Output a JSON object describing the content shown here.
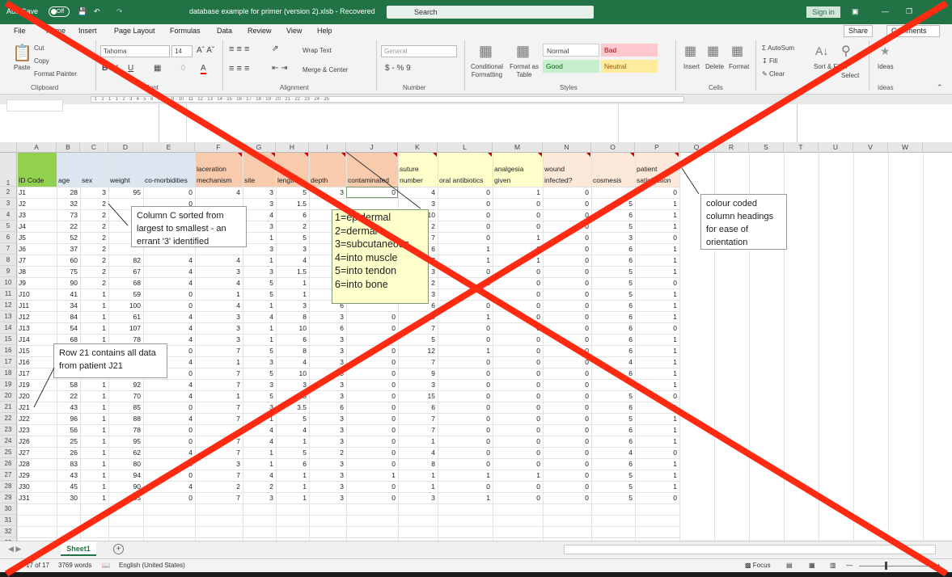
{
  "window": {
    "autosave": "AutoSave",
    "autosave_state": "Off",
    "title": "database example for primer (version 2).xlsb  -  Recovered",
    "search": "Search",
    "signin": "Sign in"
  },
  "menu": {
    "items": [
      "File",
      "Home",
      "Insert",
      "Page Layout",
      "Formulas",
      "Data",
      "Review",
      "View",
      "Help"
    ],
    "share": "Share",
    "comments": "Comments"
  },
  "ribbon": {
    "paste": "Paste",
    "cut": "Cut",
    "copy": "Copy",
    "format_painter": "Format Painter",
    "clipboard": "Clipboard",
    "font_name": "Tahoma",
    "font_size": "14",
    "font": "Font",
    "wrap_text": "Wrap Text",
    "merge_center": "Merge & Center",
    "alignment": "Alignment",
    "number_format": "General",
    "number": "Number",
    "conditional_formatting": "Conditional Formatting",
    "format_as_table": "Format as Table",
    "style_normal": "Normal",
    "style_bad": "Bad",
    "style_good": "Good",
    "style_neutral": "Neutral",
    "styles": "Styles",
    "insert": "Insert",
    "delete": "Delete",
    "format": "Format",
    "cells": "Cells",
    "autosum": "AutoSum",
    "fill": "Fill",
    "clear": "Clear",
    "sort_filter": "Sort & Filter",
    "find_select": "Select",
    "ideas": "Ideas",
    "ideas_group": "Ideas"
  },
  "columns": [
    "A",
    "B",
    "C",
    "D",
    "E",
    "F",
    "G",
    "H",
    "I",
    "J",
    "K",
    "L",
    "M",
    "N",
    "O",
    "P",
    "Q",
    "R",
    "S",
    "T",
    "U",
    "V",
    "W"
  ],
  "headers": {
    "line1": [
      "",
      "",
      "",
      "",
      "",
      "laceration",
      "",
      "",
      "",
      "",
      "suture",
      "",
      "analgesia",
      "wound",
      "",
      "patient"
    ],
    "line2": [
      "ID Code",
      "age",
      "sex",
      "weight",
      "co-morbidities",
      "mechanism",
      "site",
      "length",
      "depth",
      "contaminated",
      "number",
      "oral antibiotics",
      "given",
      "infected?",
      "cosmesis",
      "satisfaction"
    ]
  },
  "colors": {
    "excel_green": "#217346",
    "hdr_green": "#92d050",
    "hdr_blue": "#dce6f1",
    "hdr_orange": "#f8cbad",
    "hdr_yellow": "#ffffcc",
    "hdr_peach": "#fde9d9",
    "cross": "#ff2a12"
  },
  "rows": [
    [
      "J1",
      "28",
      "3",
      "95",
      "0",
      "4",
      "3",
      "5",
      "3",
      "0",
      "4",
      "0",
      "1",
      "0",
      "",
      "0"
    ],
    [
      "J2",
      "32",
      "2",
      "",
      "0",
      "",
      "3",
      "1.5",
      "",
      "",
      "3",
      "0",
      "0",
      "0",
      "5",
      "1"
    ],
    [
      "J3",
      "73",
      "2",
      "",
      "",
      "",
      "4",
      "6",
      "",
      "",
      "10",
      "0",
      "0",
      "0",
      "6",
      "1"
    ],
    [
      "J4",
      "22",
      "2",
      "",
      "",
      "",
      "3",
      "2",
      "",
      "",
      "2",
      "0",
      "0",
      "0",
      "5",
      "1"
    ],
    [
      "J5",
      "52",
      "2",
      "",
      "",
      "",
      "1",
      "5",
      "",
      "",
      "7",
      "0",
      "1",
      "0",
      "3",
      "0"
    ],
    [
      "J6",
      "37",
      "2",
      "",
      "",
      "",
      "3",
      "3",
      "",
      "",
      "6",
      "1",
      "0",
      "0",
      "6",
      "1"
    ],
    [
      "J7",
      "60",
      "2",
      "82",
      "4",
      "4",
      "1",
      "4",
      "",
      "",
      "7",
      "1",
      "1",
      "0",
      "6",
      "1"
    ],
    [
      "J8",
      "75",
      "2",
      "67",
      "4",
      "3",
      "3",
      "1.5",
      "",
      "",
      "3",
      "0",
      "0",
      "0",
      "5",
      "1"
    ],
    [
      "J9",
      "90",
      "2",
      "68",
      "4",
      "4",
      "5",
      "1",
      "",
      "",
      "2",
      "1",
      "0",
      "0",
      "5",
      "0"
    ],
    [
      "J10",
      "41",
      "1",
      "59",
      "0",
      "1",
      "5",
      "1",
      "",
      "",
      "3",
      "1",
      "0",
      "0",
      "5",
      "1"
    ],
    [
      "J11",
      "34",
      "1",
      "100",
      "0",
      "4",
      "1",
      "3",
      "6",
      "",
      "6",
      "0",
      "0",
      "0",
      "6",
      "1"
    ],
    [
      "J12",
      "84",
      "1",
      "61",
      "4",
      "3",
      "4",
      "8",
      "3",
      "0",
      "0",
      "1",
      "0",
      "0",
      "6",
      "1"
    ],
    [
      "J13",
      "54",
      "1",
      "107",
      "4",
      "3",
      "1",
      "10",
      "6",
      "0",
      "7",
      "0",
      "0",
      "0",
      "6",
      "0"
    ],
    [
      "J14",
      "68",
      "1",
      "78",
      "4",
      "3",
      "1",
      "6",
      "3",
      "0",
      "5",
      "0",
      "0",
      "0",
      "6",
      "1"
    ],
    [
      "J15",
      "",
      "",
      "",
      "0",
      "7",
      "5",
      "8",
      "3",
      "0",
      "12",
      "1",
      "0",
      "0",
      "6",
      "1"
    ],
    [
      "J16",
      "",
      "",
      "",
      "4",
      "1",
      "3",
      "4",
      "3",
      "0",
      "7",
      "0",
      "0",
      "0",
      "4",
      "1"
    ],
    [
      "J17",
      "",
      "",
      "",
      "0",
      "7",
      "5",
      "10",
      "3",
      "0",
      "9",
      "0",
      "0",
      "0",
      "6",
      "1"
    ],
    [
      "J19",
      "58",
      "1",
      "92",
      "4",
      "7",
      "3",
      "3",
      "3",
      "0",
      "3",
      "0",
      "0",
      "0",
      "",
      "1"
    ],
    [
      "J20",
      "22",
      "1",
      "70",
      "4",
      "1",
      "5",
      "8",
      "3",
      "0",
      "15",
      "0",
      "0",
      "0",
      "5",
      "0"
    ],
    [
      "J21",
      "43",
      "1",
      "85",
      "0",
      "7",
      "3",
      "3.5",
      "6",
      "0",
      "6",
      "0",
      "0",
      "0",
      "6",
      "1"
    ],
    [
      "J22",
      "96",
      "1",
      "88",
      "4",
      "7",
      "1",
      "5",
      "3",
      "0",
      "7",
      "0",
      "0",
      "0",
      "5",
      "1"
    ],
    [
      "J23",
      "56",
      "1",
      "78",
      "0",
      "",
      "4",
      "4",
      "3",
      "0",
      "7",
      "0",
      "0",
      "0",
      "6",
      "1"
    ],
    [
      "J26",
      "25",
      "1",
      "95",
      "0",
      "7",
      "4",
      "1",
      "3",
      "0",
      "1",
      "0",
      "0",
      "0",
      "6",
      "1"
    ],
    [
      "J27",
      "26",
      "1",
      "62",
      "4",
      "7",
      "1",
      "5",
      "2",
      "0",
      "4",
      "0",
      "0",
      "0",
      "4",
      "0"
    ],
    [
      "J28",
      "83",
      "1",
      "80",
      "4",
      "3",
      "1",
      "6",
      "3",
      "0",
      "8",
      "0",
      "0",
      "0",
      "6",
      "1"
    ],
    [
      "J29",
      "43",
      "1",
      "94",
      "0",
      "7",
      "4",
      "1",
      "3",
      "1",
      "1",
      "1",
      "1",
      "0",
      "5",
      "1"
    ],
    [
      "J30",
      "45",
      "1",
      "90",
      "4",
      "2",
      "2",
      "1",
      "3",
      "0",
      "1",
      "0",
      "0",
      "0",
      "5",
      "1"
    ],
    [
      "J31",
      "30",
      "1",
      "55",
      "0",
      "7",
      "3",
      "1",
      "3",
      "0",
      "3",
      "1",
      "0",
      "0",
      "5",
      "0"
    ]
  ],
  "row_numbers": [
    "1",
    "2",
    "3",
    "4",
    "5",
    "6",
    "7",
    "8",
    "9",
    "10",
    "11",
    "12",
    "13",
    "14",
    "15",
    "16",
    "17",
    "18",
    "19",
    "20",
    "21",
    "22",
    "23",
    "24",
    "25",
    "26",
    "27",
    "28",
    "29",
    "30",
    "31",
    "32",
    "33"
  ],
  "callouts": {
    "sorted": "Column C sorted from largest to smallest - an errant '3' identified",
    "row21": "Row 21 contains all data from patient J21",
    "colour": "colour coded column headings for ease of orientation",
    "depth_legend": [
      "1=epidermal",
      "2=dermal",
      "3=subcutaneous",
      "4=into muscle",
      "5=into tendon",
      "6=into bone"
    ]
  },
  "sheet": {
    "tab": "Sheet1"
  },
  "status": {
    "page": "17 of 17",
    "words": "3769 words",
    "language": "English (United States)",
    "focus": "Focus"
  }
}
